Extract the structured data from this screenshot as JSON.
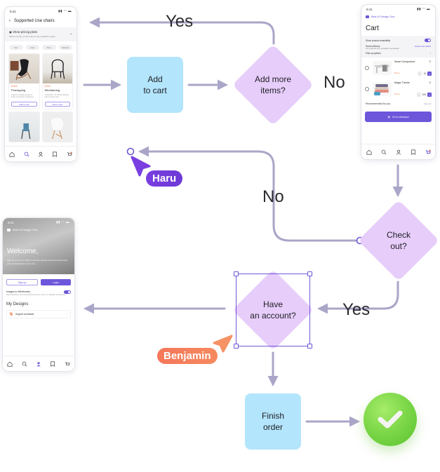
{
  "colors": {
    "connector": "#aaa6c8",
    "process_fill": "#b3e5fc",
    "decision_fill": "#e7cdfa",
    "selection": "#6f57d8",
    "haru": "#7a3fe0",
    "benjamin": "#f4775a",
    "success": "#7ed84a",
    "brand_purple": "#6e56db"
  },
  "flow": {
    "nodes": {
      "add_to_cart": "Add\nto cart",
      "add_more_items": "Add more\nitems?",
      "check_out": "Check\nout?",
      "have_account": "Have\nan account?",
      "finish_order": "Finish\norder"
    },
    "edge_labels": {
      "yes_top": "Yes",
      "no_right": "No",
      "no_middle": "No",
      "yes_bottom": "Yes"
    },
    "cursors": [
      {
        "name": "Haru",
        "color": "#7a3fe0"
      },
      {
        "name": "Benjamin",
        "color": "#f4775a"
      }
    ],
    "done_icon": "checkmark-icon"
  },
  "phone_products": {
    "status_time": "9:41",
    "title": "Supported Use chairs",
    "banner_title": "Show pricing plans",
    "banner_sub": "Select country or Zip code to see available region",
    "chips": [
      "Sort",
      "Color",
      "Price",
      "Material"
    ],
    "cards": [
      {
        "price": "$ free",
        "name": "Prototyping",
        "desc": "Support multiple people to share interactive prototypes",
        "button": "Add to cart"
      },
      {
        "price": "$ free",
        "name": "Wireframing",
        "desc": "A powerful, un-stifling drawing area to bring risks",
        "button": "Add to cart"
      }
    ],
    "tabs": [
      "home-icon",
      "search-icon",
      "user-icon",
      "bookmark-icon",
      "cart-icon"
    ]
  },
  "phone_cart": {
    "status_time": "9:41",
    "brand": "Best UI Design Tool",
    "title": "Cart",
    "show_availability": "Show product availability",
    "home_delivery": "Home delivery",
    "postal_code": "Postal code 10001",
    "all_available": "All products are available worldwide",
    "pickup": "Pick-up options",
    "items": [
      {
        "name": "Smart Component",
        "price": "$ free",
        "qty": "10"
      },
      {
        "name": "Magic Theme",
        "price": "$ free",
        "qty": "100"
      }
    ],
    "recommended": "Recommended for you",
    "view_all": "View all",
    "checkout": "Go to checkout"
  },
  "phone_welcome": {
    "status_time": "9:41",
    "brand": "Best UI Design Tool",
    "welcome": "Welcome,",
    "welcome_sub": "Sign up or log in to Vitely to access special AI features and make your product dream come true",
    "signup": "Sign up",
    "login": "Login",
    "images_title": "Images to Wireframes",
    "images_sub": "Scan sketches and screenshot and turn them to editable wireframes",
    "my_designs": "My Designs",
    "support": "Support worldwide"
  }
}
